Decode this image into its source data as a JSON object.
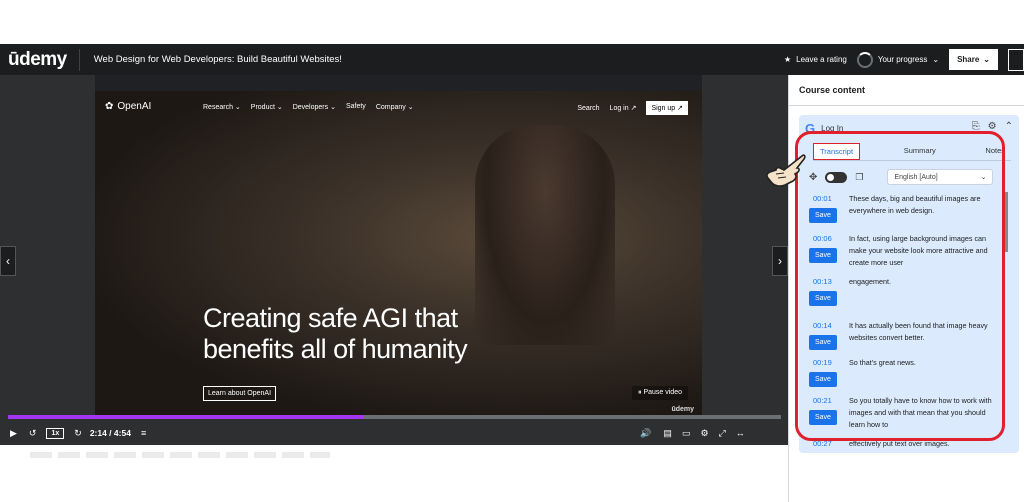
{
  "header": {
    "logo": "ūdemy",
    "course_title": "Web Design for Web Developers: Build Beautiful Websites!",
    "rating_label": "Leave a rating",
    "progress_label": "Your progress",
    "share_label": "Share"
  },
  "video": {
    "site": {
      "logo": "OpenAI",
      "nav": [
        "Research",
        "Product",
        "Developers",
        "Safety",
        "Company"
      ],
      "search": "Search",
      "login": "Log in ↗",
      "signup": "Sign up ↗",
      "hero_line1": "Creating safe AGI that",
      "hero_line2": "benefits all of humanity",
      "learn": "Learn about OpenAI",
      "pause": "⏸ Pause video",
      "watermark": "ūdemy"
    },
    "progress": 0.46,
    "speed": "1x",
    "time": "2:14 / 4:54"
  },
  "panel": {
    "title": "Course content",
    "login": "Log In",
    "tabs": [
      "Transcript",
      "Summary",
      "Notes"
    ],
    "language": "English [Auto]",
    "save_label": "Save",
    "entries": [
      {
        "time": "00:01",
        "text": "These days, big and beautiful images are everywhere in web design."
      },
      {
        "time": "00:06",
        "text": "In fact, using large background images can make your website look more attractive and create more user"
      },
      {
        "time": "00:13",
        "text": "engagement."
      },
      {
        "time": "00:14",
        "text": "It has actually been found that image heavy websites convert better."
      },
      {
        "time": "00:19",
        "text": "So that's great news."
      },
      {
        "time": "00:21",
        "text": "So you totally have to know how to work with images and with that mean that you should learn how to"
      },
      {
        "time": "00:27",
        "text": "effectively put text over images."
      }
    ]
  },
  "colors": {
    "header_bg": "#1c1d1f",
    "progress_fill": "#a435f0",
    "panel_bg": "#dbeafd",
    "accent_blue": "#1a73e8",
    "highlight_red": "#e0202d"
  }
}
